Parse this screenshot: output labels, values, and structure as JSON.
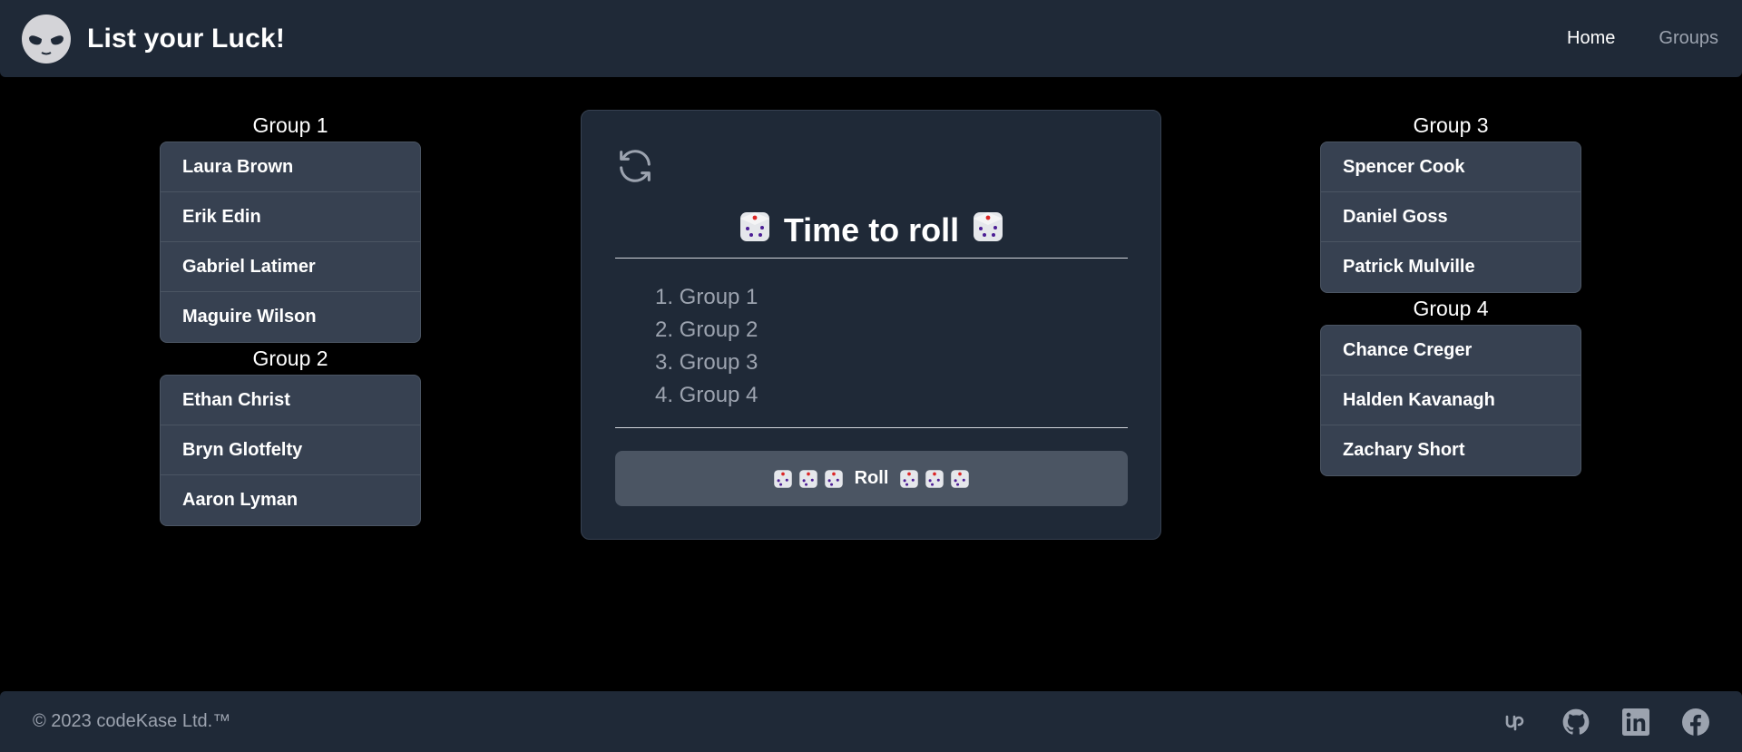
{
  "header": {
    "logo_icon": "alien-icon",
    "title": "List your Luck!",
    "nav": [
      {
        "label": "Home",
        "active": true
      },
      {
        "label": "Groups",
        "active": false
      }
    ]
  },
  "groups": [
    {
      "title": "Group 1",
      "members": [
        "Laura Brown",
        "Erik Edin",
        "Gabriel Latimer",
        "Maguire Wilson"
      ]
    },
    {
      "title": "Group 2",
      "members": [
        "Ethan Christ",
        "Bryn Glotfelty",
        "Aaron Lyman"
      ]
    },
    {
      "title": "Group 3",
      "members": [
        "Spencer Cook",
        "Daniel Goss",
        "Patrick Mulville"
      ]
    },
    {
      "title": "Group 4",
      "members": [
        "Chance Creger",
        "Halden Kavanagh",
        "Zachary Short"
      ]
    }
  ],
  "card": {
    "refresh_icon": "refresh-icon",
    "title": "Time to roll",
    "order": [
      "1. Group 1",
      "2. Group 2",
      "3. Group 3",
      "4. Group 4"
    ],
    "roll_label": "Roll"
  },
  "footer": {
    "copyright": "© 2023 codeKase Ltd.™",
    "socials": [
      "upwork-icon",
      "github-icon",
      "linkedin-icon",
      "facebook-icon"
    ]
  },
  "colors": {
    "background": "#000000",
    "panel": "#1f2937",
    "list_item": "#374151",
    "button": "#4b5563",
    "muted_text": "#9ca3af"
  }
}
